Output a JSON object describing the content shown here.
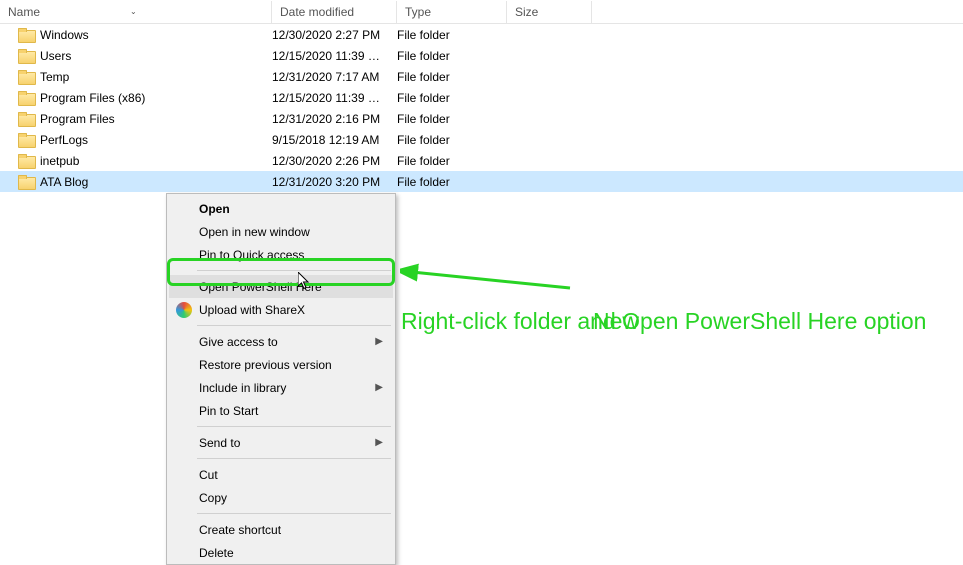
{
  "columns": {
    "name": "Name",
    "date": "Date modified",
    "type": "Type",
    "size": "Size"
  },
  "rows": [
    {
      "name": "Windows",
      "date": "12/30/2020 2:27 PM",
      "type": "File folder",
      "selected": false
    },
    {
      "name": "Users",
      "date": "12/15/2020 11:39 …",
      "type": "File folder",
      "selected": false
    },
    {
      "name": "Temp",
      "date": "12/31/2020 7:17 AM",
      "type": "File folder",
      "selected": false
    },
    {
      "name": "Program Files (x86)",
      "date": "12/15/2020 11:39 …",
      "type": "File folder",
      "selected": false
    },
    {
      "name": "Program Files",
      "date": "12/31/2020 2:16 PM",
      "type": "File folder",
      "selected": false
    },
    {
      "name": "PerfLogs",
      "date": "9/15/2018 12:19 AM",
      "type": "File folder",
      "selected": false
    },
    {
      "name": "inetpub",
      "date": "12/30/2020 2:26 PM",
      "type": "File folder",
      "selected": false
    },
    {
      "name": "ATA Blog",
      "date": "12/31/2020 3:20 PM",
      "type": "File folder",
      "selected": true
    }
  ],
  "menu": {
    "open": "Open",
    "open_new": "Open in new window",
    "pin_quick": "Pin to Quick access",
    "powershell": "Open PowerShell Here",
    "sharex": "Upload with ShareX",
    "give_access": "Give access to",
    "restore_prev": "Restore previous version",
    "include_lib": "Include in library",
    "pin_start": "Pin to Start",
    "send_to": "Send to",
    "cut": "Cut",
    "copy": "Copy",
    "create_shortcut": "Create shortcut",
    "delete": "Delete"
  },
  "annotation": {
    "new": "New",
    "text": "Right-click folder and Open PowerShell Here option"
  }
}
